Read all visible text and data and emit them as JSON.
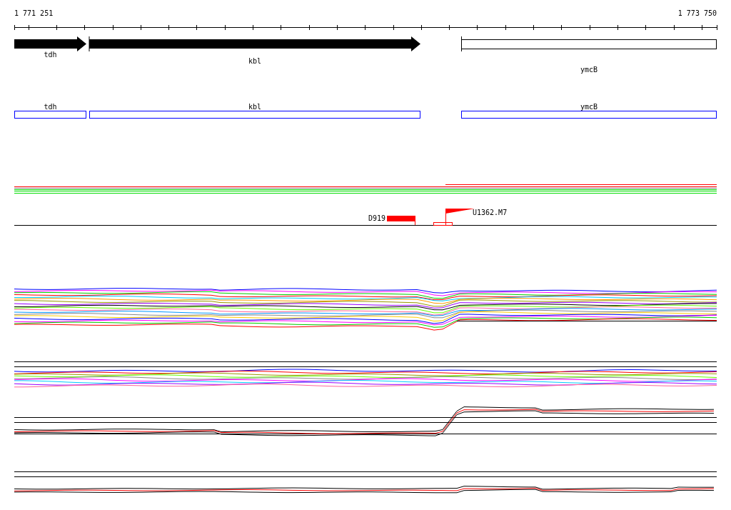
{
  "ruler": {
    "start": "1 771 251",
    "end": "1 773 750"
  },
  "genes": [
    {
      "label": "tdh",
      "kind": "arrow"
    },
    {
      "label": "kbl",
      "kind": "arrow"
    },
    {
      "label": "ymcB",
      "kind": "outline"
    }
  ],
  "annotations": [
    {
      "label": "tdh"
    },
    {
      "label": "kbl"
    },
    {
      "label": "ymcB"
    }
  ],
  "features": [
    {
      "label": "D919",
      "kind": "block"
    },
    {
      "label": "U1362.M7",
      "kind": "flag"
    }
  ]
}
